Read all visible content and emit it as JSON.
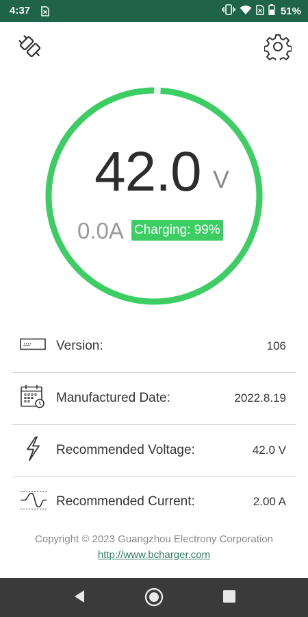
{
  "status_bar": {
    "time": "4:37",
    "battery_percent": "51%",
    "icons": [
      "sim-card-icon",
      "vibrate-icon",
      "wifi-icon",
      "no-sim-icon",
      "battery-icon"
    ]
  },
  "header": {
    "left_icon": "plug-icon",
    "right_icon": "gear-icon"
  },
  "gauge": {
    "voltage": "42.0",
    "voltage_unit": "V",
    "current": "0.0A",
    "status": "Charging: 99%",
    "ring_color": "#3dce63",
    "progress_fraction": 0.99
  },
  "info": [
    {
      "icon": "version-icon",
      "label": "Version:",
      "value": "106"
    },
    {
      "icon": "calendar-icon",
      "label": "Manufactured Date:",
      "value": "2022.8.19"
    },
    {
      "icon": "lightning-icon",
      "label": "Recommended Voltage:",
      "value": "42.0 V"
    },
    {
      "icon": "waveform-icon",
      "label": "Recommended Current:",
      "value": "2.00 A"
    }
  ],
  "footer": {
    "copyright": "Copyright © 2023 Guangzhou Electrony Corporation",
    "link": "http://www.bcharger.com"
  },
  "colors": {
    "status_bar": "#1f6348",
    "accent": "#3dce63",
    "nav_bar": "#3a3a3a"
  }
}
